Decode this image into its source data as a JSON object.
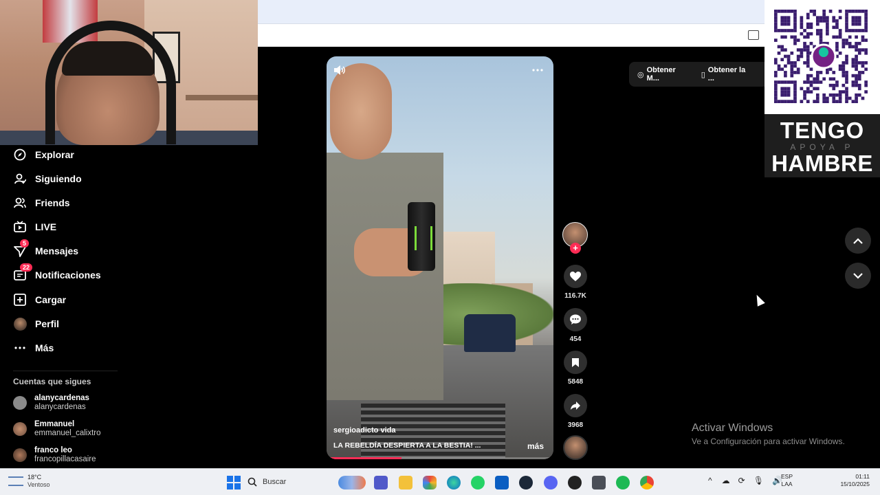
{
  "sidebar": {
    "items": [
      {
        "label": "Explorar",
        "icon": "compass-icon"
      },
      {
        "label": "Siguiendo",
        "icon": "following-icon"
      },
      {
        "label": "Friends",
        "icon": "friends-icon"
      },
      {
        "label": "LIVE",
        "icon": "live-icon"
      },
      {
        "label": "Mensajes",
        "icon": "messages-icon",
        "badge": "5"
      },
      {
        "label": "Notificaciones",
        "icon": "notifications-icon",
        "badge": "22"
      },
      {
        "label": "Cargar",
        "icon": "upload-icon"
      },
      {
        "label": "Perfil",
        "icon": "profile-avatar"
      },
      {
        "label": "Más",
        "icon": "more-icon"
      }
    ],
    "following_title": "Cuentas que sigues",
    "accounts": [
      {
        "name": "alanycardenas",
        "handle": "alanycardenas"
      },
      {
        "name": "Emmanuel",
        "handle": "emmanuel_calixtro"
      },
      {
        "name": "franco leo",
        "handle": "francopillacasaire"
      }
    ]
  },
  "video": {
    "author": "sergioadicto vida",
    "caption": "LA REBELDÍA DESPIERTA A LA BESTIA! ...",
    "more_label": "más",
    "progress": 0.33
  },
  "actions": {
    "likes": "116.7K",
    "comments": "454",
    "saves": "5848",
    "shares": "3968"
  },
  "get_app": {
    "item1": "Obtener M...",
    "item2": "Obtener la ..."
  },
  "promo": {
    "line1": "TENGO",
    "line2": "APOYA P",
    "line3": "HAMBRE"
  },
  "watermark": {
    "title": "Activar Windows",
    "subtitle": "Ve a Configuración para activar Windows."
  },
  "taskbar": {
    "temperature": "18°C",
    "condition": "Ventoso",
    "search_placeholder": "Buscar",
    "lang_line1": "ESP",
    "lang_line2": "LAA",
    "time": "01:11",
    "date": "15/10/2025"
  },
  "colors": {
    "accent": "#fe2c55",
    "background": "#000000"
  }
}
